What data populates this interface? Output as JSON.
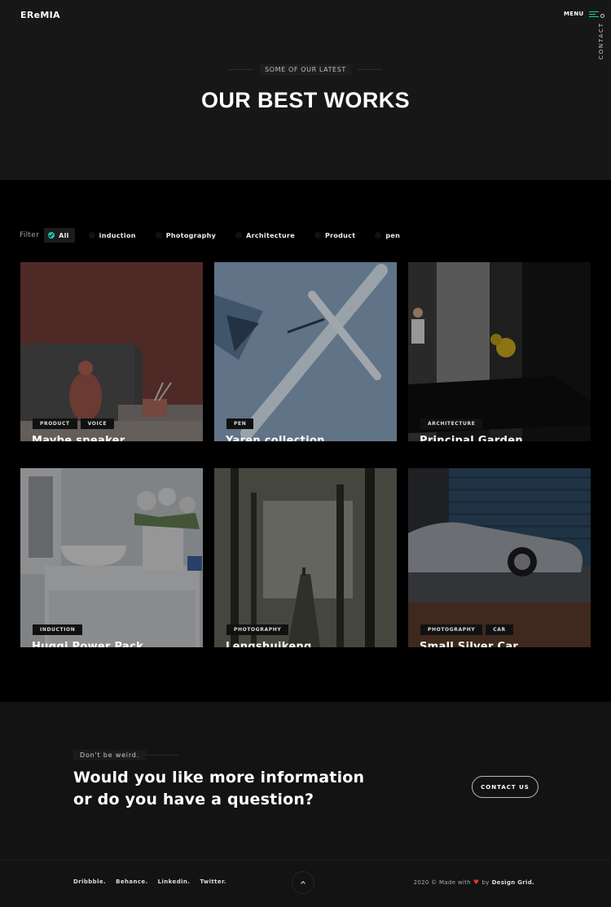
{
  "header": {
    "logo": "EReMIA",
    "menu_label": "MENU",
    "contact_label": "CONTACT",
    "eyebrow": "SOME OF OUR LATEST",
    "title": "OUR BEST WORKS"
  },
  "filters": {
    "label": "Filter",
    "items": [
      {
        "label": "All",
        "active": true
      },
      {
        "label": "induction",
        "active": false
      },
      {
        "label": "Photography",
        "active": false
      },
      {
        "label": "Architecture",
        "active": false
      },
      {
        "label": "Product",
        "active": false
      },
      {
        "label": "pen",
        "active": false
      }
    ]
  },
  "works": [
    {
      "title": "Maybe speaker",
      "tags": [
        "PRODUCT",
        "VOICE"
      ]
    },
    {
      "title": "Yaren collection",
      "tags": [
        "PEN"
      ]
    },
    {
      "title": "Principal Garden",
      "tags": [
        "ARCHITECTURE"
      ]
    },
    {
      "title": "Huggi Power Pack",
      "tags": [
        "INDUCTION"
      ]
    },
    {
      "title": "Lengshuikeng",
      "tags": [
        "PHOTOGRAPHY"
      ]
    },
    {
      "title": "Small Silver Car",
      "tags": [
        "PHOTOGRAPHY",
        "CAR"
      ]
    }
  ],
  "cta": {
    "eyebrow": "Don't be weird.",
    "title_line1": "Would you like more information",
    "title_line2": "or do you have a question?",
    "button_label": "CONTACT US"
  },
  "footer": {
    "social": [
      "Dribbble.",
      "Behance.",
      "Linkedin.",
      "Twitter."
    ],
    "copy_prefix": "2020 © Made with",
    "copy_by": "by",
    "copy_brand": "Design Grid."
  },
  "colors": {
    "accent": "#1ec7b4",
    "heart": "#e0363a",
    "background": "#141414",
    "works_background": "#000000"
  }
}
